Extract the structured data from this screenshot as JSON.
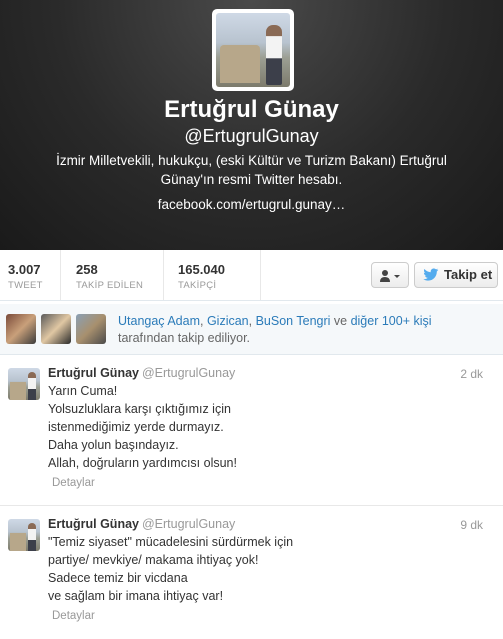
{
  "profile": {
    "name": "Ertuğrul Günay",
    "handle": "@ErtugrulGunay",
    "bio": "İzmir Milletvekili, hukukçu, (eski Kültür ve Turizm Bakanı) Ertuğrul Günay'ın resmi Twitter hesabı.",
    "website": "facebook.com/ertugrul.gunay…"
  },
  "stats": [
    {
      "value": "3.007",
      "label": "TWEET"
    },
    {
      "value": "258",
      "label": "TAKİP EDİLEN"
    },
    {
      "value": "165.040",
      "label": "TAKİPÇİ"
    }
  ],
  "actions": {
    "follow_label": "Takip et",
    "user_menu_icon": "person-dropdown-icon",
    "follow_icon": "twitter-bird-icon"
  },
  "followed_by": {
    "names": [
      "Utangaç Adam",
      "Gizican",
      "BuSon Tengri"
    ],
    "sep1": ", ",
    "sep2": ", ",
    "and_text": " ve ",
    "more_text": "diğer 100+ kişi",
    "suffix": "tarafından takip ediliyor."
  },
  "tweets": [
    {
      "author": "Ertuğrul Günay",
      "handle": "@ErtugrulGunay",
      "time": "2 dk",
      "lines": [
        "Yarın Cuma!",
        "Yolsuzluklara karşı çıktığımız için",
        "istenmediğimiz yerde durmayız.",
        "Daha yolun başındayız.",
        "Allah, doğruların yardımcısı olsun!"
      ],
      "detail_label": "Detaylar"
    },
    {
      "author": "Ertuğrul Günay",
      "handle": "@ErtugrulGunay",
      "time": "9 dk",
      "lines": [
        "\"Temiz siyaset\" mücadelesini sürdürmek için",
        "partiye/ mevkiye/ makama ihtiyaç yok!",
        "Sadece temiz bir vicdana",
        "ve sağlam bir imana ihtiyaç var!"
      ],
      "detail_label": "Detaylar"
    }
  ],
  "colors": {
    "link": "#2b7bb9",
    "twitter_blue": "#55acee",
    "header_bg": "#2a2a2a"
  }
}
